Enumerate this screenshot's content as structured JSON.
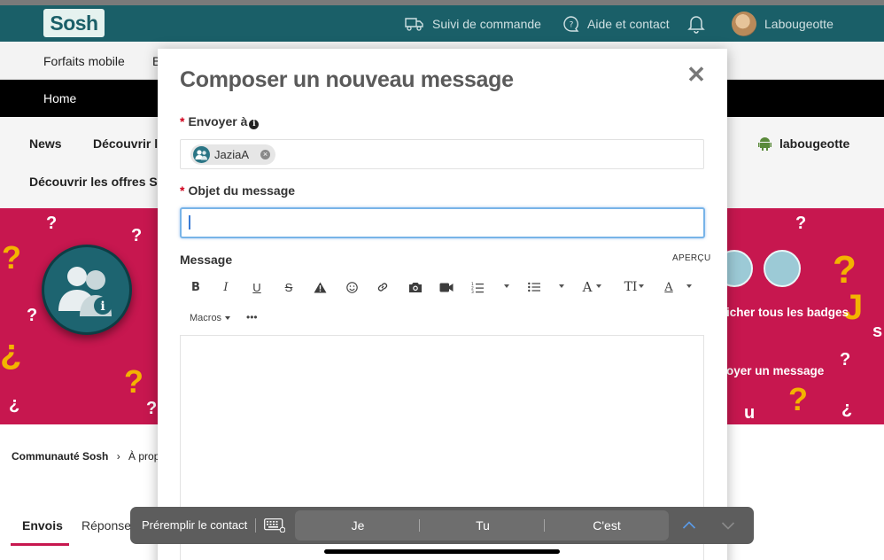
{
  "header": {
    "logo": "Sosh",
    "order_tracking": "Suivi de commande",
    "help": "Aide et contact",
    "username": "Labougeotte"
  },
  "nav": {
    "primary": [
      "Forfaits mobile",
      "B"
    ],
    "secondary": "Home",
    "community": [
      "News",
      "Découvrir la",
      "Découvrir les offres Sos"
    ],
    "user": "labougeotte"
  },
  "banner": {
    "all_badges": "icher tous les badges",
    "send_message": "oyer un message"
  },
  "breadcrumb": [
    "Communauté Sosh",
    "À propo"
  ],
  "tabs": [
    "Envois",
    "Réponses"
  ],
  "modal": {
    "title": "Composer un nouveau message",
    "close": "✕",
    "to_label": "Envoyer à",
    "recipient": "JaziaA",
    "subject_label": "Objet du message",
    "subject_value": "",
    "message_label": "Message",
    "preview": "APERÇU",
    "macros": "Macros",
    "more": "•••",
    "toolbar_icons": [
      "bold-icon",
      "italic-icon",
      "underline-icon",
      "strikethrough-icon",
      "warning-icon",
      "emoji-icon",
      "link-icon",
      "camera-icon",
      "video-icon",
      "ordered-list-icon",
      "unordered-list-icon",
      "font-icon",
      "text-size-icon",
      "text-color-icon"
    ]
  },
  "keyboard_bar": {
    "prefill": "Préremplir le contact",
    "suggestions": [
      "Je",
      "Tu",
      "C'est"
    ]
  },
  "colors": {
    "header": "#1a5f68",
    "banner": "#c7174f",
    "accent_yellow": "#f3b300",
    "focus_blue": "#78b4e8",
    "required_red": "#d0001b"
  }
}
